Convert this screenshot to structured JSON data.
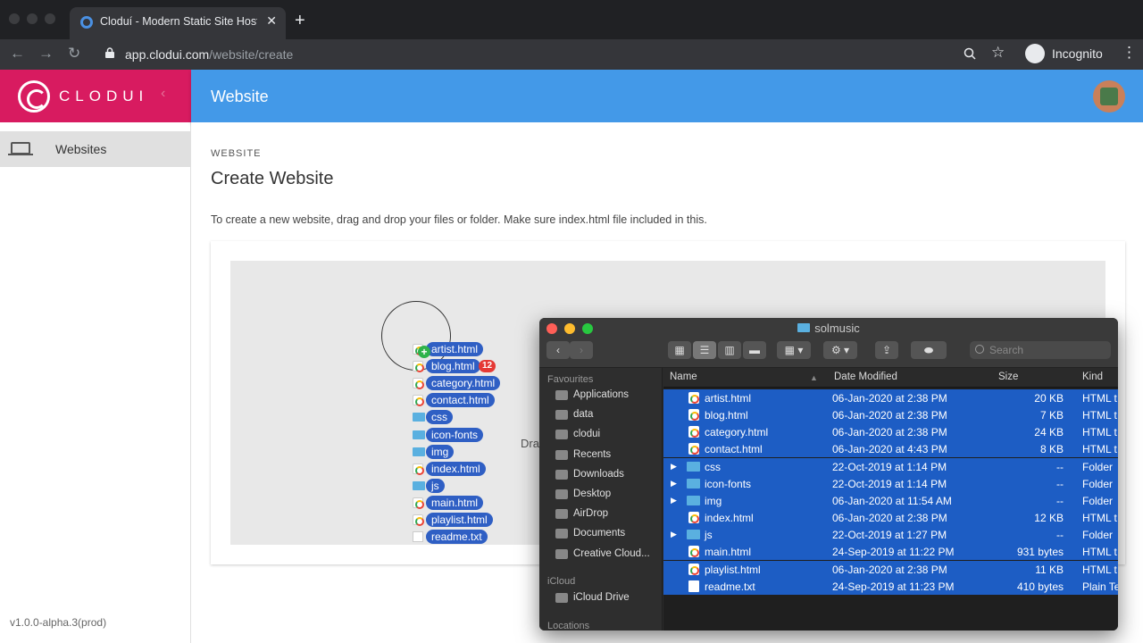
{
  "browser": {
    "tab_title": "Cloduí - Modern Static Site Hosting",
    "url_host": "app.clodui.com",
    "url_path": "/website/create",
    "incognito_label": "Incognito"
  },
  "sidebar": {
    "brand": "CLODUI",
    "items": [
      {
        "label": "Websites",
        "icon": "laptop-icon"
      }
    ],
    "version": "v1.0.0-alpha.3(prod)"
  },
  "appbar": {
    "title": "Website"
  },
  "main": {
    "overline": "WEBSITE",
    "title": "Create Website",
    "description": "To create a new website, drag and drop your files or folder. Make sure index.html file included in this.",
    "drop_text": "Dra"
  },
  "drag": {
    "badge": "12",
    "items": [
      {
        "name": "artist.html",
        "type": "doc"
      },
      {
        "name": "blog.html",
        "type": "doc"
      },
      {
        "name": "category.html",
        "type": "doc"
      },
      {
        "name": "contact.html",
        "type": "doc"
      },
      {
        "name": "css",
        "type": "folder"
      },
      {
        "name": "icon-fonts",
        "type": "folder"
      },
      {
        "name": "img",
        "type": "folder"
      },
      {
        "name": "index.html",
        "type": "doc"
      },
      {
        "name": "js",
        "type": "folder"
      },
      {
        "name": "main.html",
        "type": "doc"
      },
      {
        "name": "playlist.html",
        "type": "doc"
      },
      {
        "name": "readme.txt",
        "type": "plain"
      }
    ]
  },
  "finder": {
    "title": "solmusic",
    "search_placeholder": "Search",
    "sidebar": {
      "favourites_heading": "Favourites",
      "favourites": [
        "Applications",
        "data",
        "clodui",
        "Recents",
        "Downloads",
        "Desktop",
        "AirDrop",
        "Documents",
        "Creative Cloud..."
      ],
      "icloud_heading": "iCloud",
      "icloud": [
        "iCloud Drive"
      ],
      "locations_heading": "Locations"
    },
    "columns": {
      "name": "Name",
      "date": "Date Modified",
      "size": "Size",
      "kind": "Kind"
    },
    "rows": [
      {
        "name": "artist.html",
        "date": "06-Jan-2020 at 2:38 PM",
        "size": "20 KB",
        "kind": "HTML t",
        "type": "doc"
      },
      {
        "name": "blog.html",
        "date": "06-Jan-2020 at 2:38 PM",
        "size": "7 KB",
        "kind": "HTML t",
        "type": "doc"
      },
      {
        "name": "category.html",
        "date": "06-Jan-2020 at 2:38 PM",
        "size": "24 KB",
        "kind": "HTML t",
        "type": "doc"
      },
      {
        "name": "contact.html",
        "date": "06-Jan-2020 at 4:43 PM",
        "size": "8 KB",
        "kind": "HTML t",
        "type": "doc"
      },
      {
        "name": "css",
        "date": "22-Oct-2019 at 1:14 PM",
        "size": "--",
        "kind": "Folder",
        "type": "folder"
      },
      {
        "name": "icon-fonts",
        "date": "22-Oct-2019 at 1:14 PM",
        "size": "--",
        "kind": "Folder",
        "type": "folder"
      },
      {
        "name": "img",
        "date": "06-Jan-2020 at 11:54 AM",
        "size": "--",
        "kind": "Folder",
        "type": "folder"
      },
      {
        "name": "index.html",
        "date": "06-Jan-2020 at 2:38 PM",
        "size": "12 KB",
        "kind": "HTML t",
        "type": "doc"
      },
      {
        "name": "js",
        "date": "22-Oct-2019 at 1:27 PM",
        "size": "--",
        "kind": "Folder",
        "type": "folder"
      },
      {
        "name": "main.html",
        "date": "24-Sep-2019 at 11:22 PM",
        "size": "931 bytes",
        "kind": "HTML t",
        "type": "doc"
      },
      {
        "name": "playlist.html",
        "date": "06-Jan-2020 at 2:38 PM",
        "size": "11 KB",
        "kind": "HTML t",
        "type": "doc"
      },
      {
        "name": "readme.txt",
        "date": "24-Sep-2019 at 11:23 PM",
        "size": "410 bytes",
        "kind": "Plain Te",
        "type": "plain"
      }
    ]
  },
  "colors": {
    "brand": "#d81b60",
    "appbar": "#4399e8",
    "selection": "#1d5dc4"
  }
}
